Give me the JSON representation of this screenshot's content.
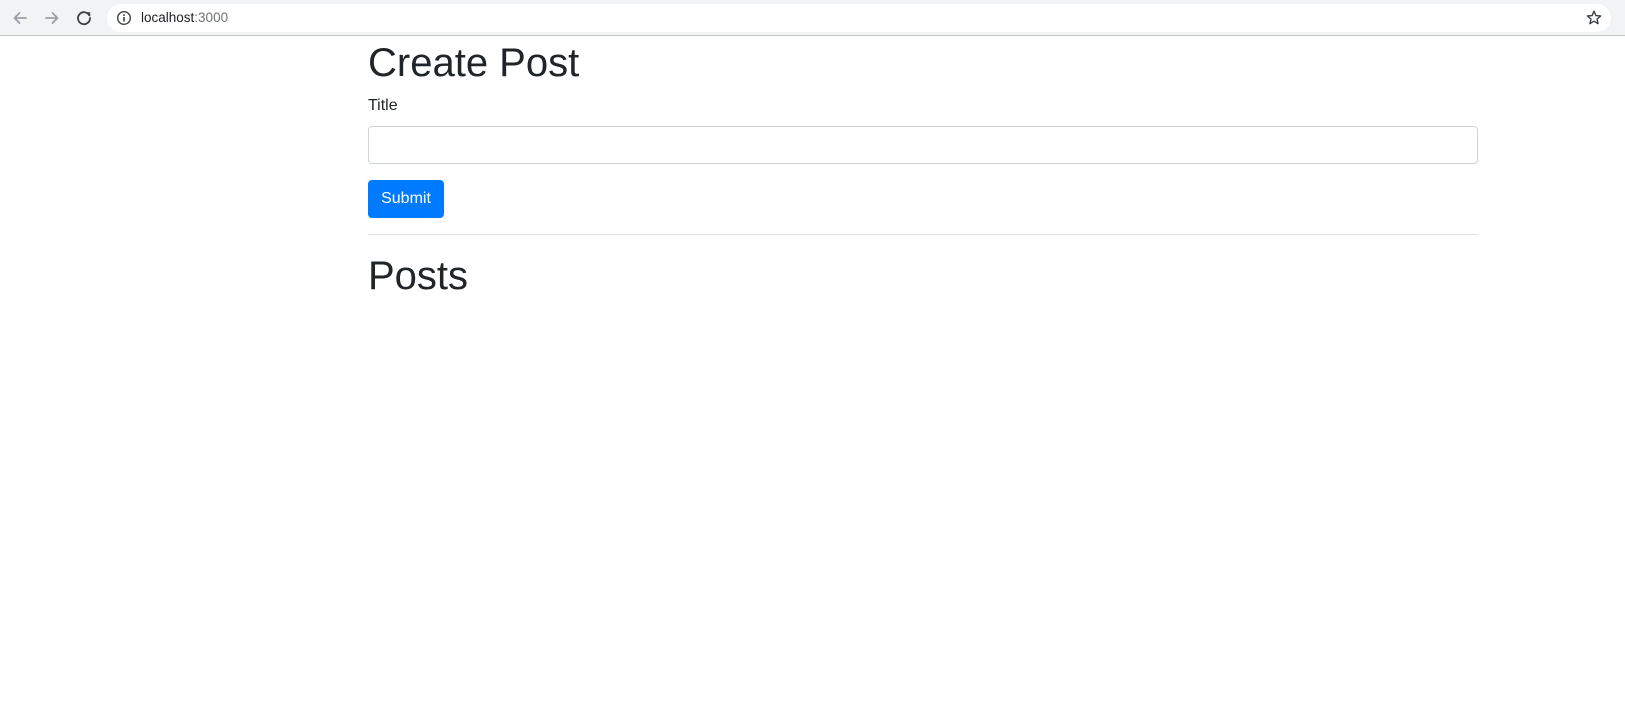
{
  "browser": {
    "url_host": "localhost",
    "url_port": ":3000",
    "icons": {
      "back": "arrow-left-icon",
      "forward": "arrow-right-icon",
      "reload": "reload-icon",
      "info": "info-icon",
      "bookmark": "star-icon"
    }
  },
  "form": {
    "heading": "Create Post",
    "title_label": "Title",
    "title_value": "",
    "submit_label": "Submit"
  },
  "posts": {
    "heading": "Posts",
    "items": []
  },
  "colors": {
    "primary": "#007bff",
    "text": "#212529",
    "input_border": "#ced4da",
    "divider": "#dee2e6",
    "browser_bar": "#f1f3f4"
  }
}
